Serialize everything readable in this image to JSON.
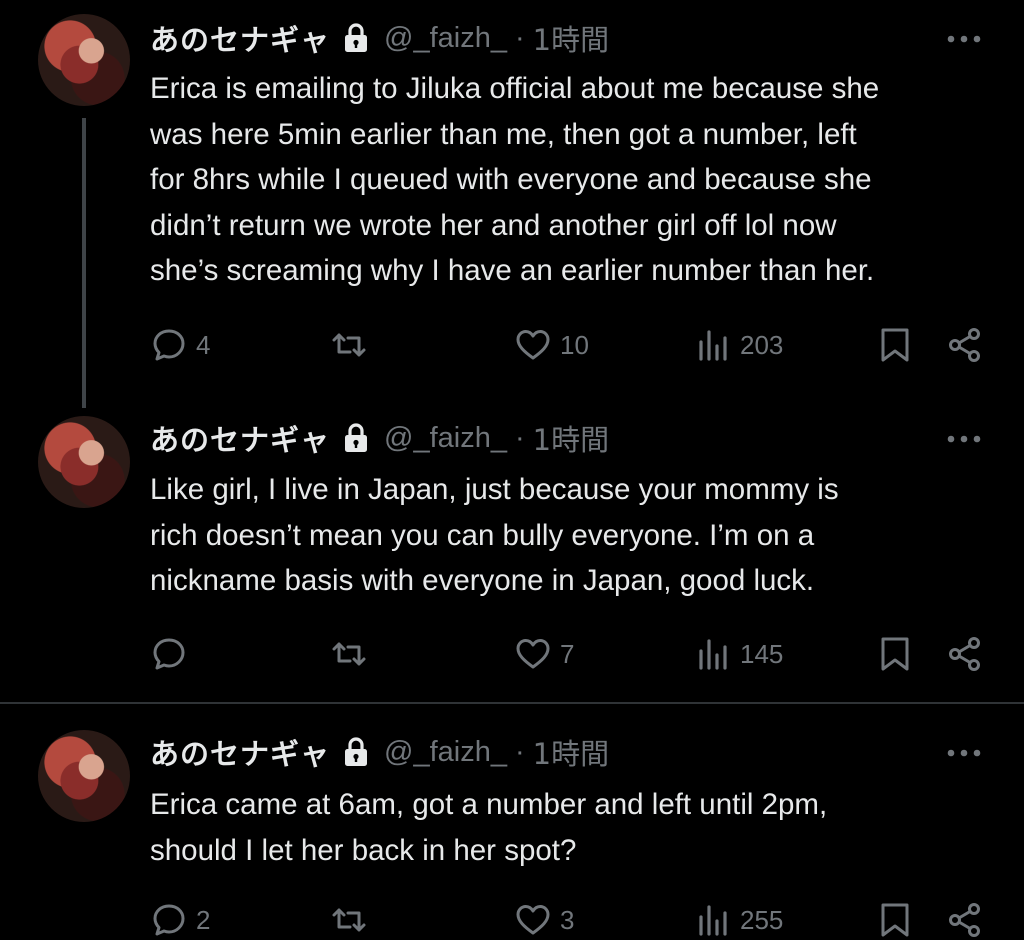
{
  "tweets": [
    {
      "name": "あのセナギャ",
      "handle": "@_faizh_",
      "separator": "·",
      "time": "1時間",
      "text": "Erica is emailing to Jiluka official about me because she\nwas here 5min earlier than me, then got a number, left\nfor 8hrs while I queued with everyone and because she\ndidn’t return we wrote her and another girl off lol now\nshe’s screaming why I have an earlier number than her.",
      "replies": "4",
      "retweets": "",
      "likes": "10",
      "views": "203"
    },
    {
      "name": "あのセナギャ",
      "handle": "@_faizh_",
      "separator": "·",
      "time": "1時間",
      "text": "Like girl, I live in Japan, just because your mommy is\nrich doesn’t mean you can bully everyone. I’m on a\nnickname basis with everyone in Japan, good luck.",
      "replies": "",
      "retweets": "",
      "likes": "7",
      "views": "145"
    },
    {
      "name": "あのセナギャ",
      "handle": "@_faizh_",
      "separator": "·",
      "time": "1時間",
      "text": "Erica came at 6am, got a number and left until 2pm,\nshould I let her back in her spot?",
      "replies": "2",
      "retweets": "",
      "likes": "3",
      "views": "255"
    }
  ],
  "icons": {
    "reply": "reply-icon",
    "retweet": "retweet-icon",
    "like": "heart-icon",
    "views": "views-icon",
    "bookmark": "bookmark-icon",
    "share": "share-icon",
    "lock": "lock-icon",
    "more": "more-icon"
  },
  "colors": {
    "background": "#000000",
    "text": "#e7e9ea",
    "secondary": "#71767b",
    "divider": "#2f3336"
  }
}
